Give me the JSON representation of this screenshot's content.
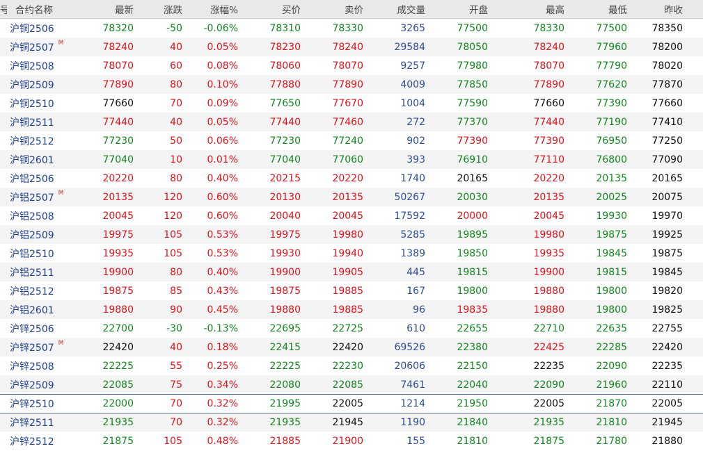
{
  "header": {
    "idx": "号",
    "name": "合约名称",
    "last": "最新",
    "chg": "涨跌",
    "pct": "涨幅%",
    "bid": "买价",
    "ask": "卖价",
    "vol": "成交量",
    "open": "开盘",
    "high": "最高",
    "low": "最低",
    "prev": "昨收"
  },
  "colors": {
    "up": "#e0121b",
    "down": "#12861f",
    "flat": "#111111",
    "name": "#1e3f91",
    "volume": "#2d4d94"
  },
  "rows": [
    {
      "name": "沪铜2506",
      "mark": "",
      "last": "78320",
      "chg": "-50",
      "pct": "-0.06%",
      "bid": "78310",
      "ask": "78330",
      "vol": "3265",
      "open": "77500",
      "high": "78330",
      "low": "77500",
      "prev": "78350"
    },
    {
      "name": "沪铜2507",
      "mark": "M",
      "last": "78240",
      "chg": "40",
      "pct": "0.05%",
      "bid": "78230",
      "ask": "78240",
      "vol": "29584",
      "open": "78050",
      "high": "78240",
      "low": "77960",
      "prev": "78200"
    },
    {
      "name": "沪铜2508",
      "mark": "",
      "last": "78070",
      "chg": "60",
      "pct": "0.08%",
      "bid": "78060",
      "ask": "78070",
      "vol": "9257",
      "open": "77980",
      "high": "78070",
      "low": "77790",
      "prev": "78020"
    },
    {
      "name": "沪铜2509",
      "mark": "",
      "last": "77890",
      "chg": "80",
      "pct": "0.10%",
      "bid": "77880",
      "ask": "77890",
      "vol": "4009",
      "open": "77850",
      "high": "77890",
      "low": "77620",
      "prev": "77870"
    },
    {
      "name": "沪铜2510",
      "mark": "",
      "last": "77660",
      "chg": "70",
      "pct": "0.09%",
      "bid": "77650",
      "ask": "77670",
      "vol": "1004",
      "open": "77590",
      "high": "77660",
      "low": "77390",
      "prev": "77660"
    },
    {
      "name": "沪铜2511",
      "mark": "",
      "last": "77440",
      "chg": "40",
      "pct": "0.05%",
      "bid": "77440",
      "ask": "77460",
      "vol": "272",
      "open": "77370",
      "high": "77440",
      "low": "77190",
      "prev": "77410"
    },
    {
      "name": "沪铜2512",
      "mark": "",
      "last": "77230",
      "chg": "50",
      "pct": "0.06%",
      "bid": "77230",
      "ask": "77240",
      "vol": "902",
      "open": "77390",
      "high": "77390",
      "low": "76950",
      "prev": "77250"
    },
    {
      "name": "沪铜2601",
      "mark": "",
      "last": "77040",
      "chg": "10",
      "pct": "0.01%",
      "bid": "77040",
      "ask": "77060",
      "vol": "393",
      "open": "76910",
      "high": "77110",
      "low": "76800",
      "prev": "77090"
    },
    {
      "name": "沪铝2506",
      "mark": "",
      "last": "20220",
      "chg": "80",
      "pct": "0.40%",
      "bid": "20215",
      "ask": "20220",
      "vol": "1740",
      "open": "20165",
      "high": "20220",
      "low": "20135",
      "prev": "20165"
    },
    {
      "name": "沪铝2507",
      "mark": "M",
      "last": "20135",
      "chg": "120",
      "pct": "0.60%",
      "bid": "20130",
      "ask": "20135",
      "vol": "50267",
      "open": "20030",
      "high": "20135",
      "low": "20025",
      "prev": "20075"
    },
    {
      "name": "沪铝2508",
      "mark": "",
      "last": "20045",
      "chg": "120",
      "pct": "0.60%",
      "bid": "20040",
      "ask": "20045",
      "vol": "17592",
      "open": "20000",
      "high": "20045",
      "low": "19930",
      "prev": "19970"
    },
    {
      "name": "沪铝2509",
      "mark": "",
      "last": "19975",
      "chg": "105",
      "pct": "0.53%",
      "bid": "19975",
      "ask": "19980",
      "vol": "5285",
      "open": "19895",
      "high": "19980",
      "low": "19875",
      "prev": "19925"
    },
    {
      "name": "沪铝2510",
      "mark": "",
      "last": "19935",
      "chg": "105",
      "pct": "0.53%",
      "bid": "19930",
      "ask": "19940",
      "vol": "1389",
      "open": "19850",
      "high": "19935",
      "low": "19845",
      "prev": "19875"
    },
    {
      "name": "沪铝2511",
      "mark": "",
      "last": "19900",
      "chg": "80",
      "pct": "0.40%",
      "bid": "19900",
      "ask": "19905",
      "vol": "445",
      "open": "19815",
      "high": "19900",
      "low": "19815",
      "prev": "19845"
    },
    {
      "name": "沪铝2512",
      "mark": "",
      "last": "19875",
      "chg": "85",
      "pct": "0.43%",
      "bid": "19875",
      "ask": "19885",
      "vol": "167",
      "open": "19800",
      "high": "19880",
      "low": "19800",
      "prev": "19820"
    },
    {
      "name": "沪铝2601",
      "mark": "",
      "last": "19880",
      "chg": "90",
      "pct": "0.45%",
      "bid": "19880",
      "ask": "19885",
      "vol": "96",
      "open": "19835",
      "high": "19880",
      "low": "19800",
      "prev": "19825"
    },
    {
      "name": "沪锌2506",
      "mark": "",
      "last": "22700",
      "chg": "-30",
      "pct": "-0.13%",
      "bid": "22695",
      "ask": "22725",
      "vol": "610",
      "open": "22655",
      "high": "22710",
      "low": "22635",
      "prev": "22755"
    },
    {
      "name": "沪锌2507",
      "mark": "M",
      "last": "22420",
      "chg": "40",
      "pct": "0.18%",
      "bid": "22415",
      "ask": "22420",
      "vol": "69526",
      "open": "22380",
      "high": "22425",
      "low": "22285",
      "prev": "22420"
    },
    {
      "name": "沪锌2508",
      "mark": "",
      "last": "22225",
      "chg": "55",
      "pct": "0.25%",
      "bid": "22225",
      "ask": "22230",
      "vol": "20606",
      "open": "22150",
      "high": "22235",
      "low": "22090",
      "prev": "22235"
    },
    {
      "name": "沪锌2509",
      "mark": "",
      "last": "22085",
      "chg": "75",
      "pct": "0.34%",
      "bid": "22080",
      "ask": "22085",
      "vol": "7461",
      "open": "22040",
      "high": "22090",
      "low": "21960",
      "prev": "22110"
    },
    {
      "name": "沪锌2510",
      "mark": "",
      "last": "22000",
      "chg": "70",
      "pct": "0.32%",
      "bid": "21995",
      "ask": "22005",
      "vol": "1214",
      "open": "21950",
      "high": "22005",
      "low": "21870",
      "prev": "22005"
    },
    {
      "name": "沪锌2511",
      "mark": "",
      "last": "21935",
      "chg": "70",
      "pct": "0.32%",
      "bid": "21935",
      "ask": "21945",
      "vol": "1190",
      "open": "21840",
      "high": "21935",
      "low": "21810",
      "prev": "21945"
    },
    {
      "name": "沪锌2512",
      "mark": "",
      "last": "21875",
      "chg": "105",
      "pct": "0.48%",
      "bid": "21885",
      "ask": "21900",
      "vol": "155",
      "open": "21810",
      "high": "21875",
      "low": "21780",
      "prev": "21880"
    }
  ]
}
